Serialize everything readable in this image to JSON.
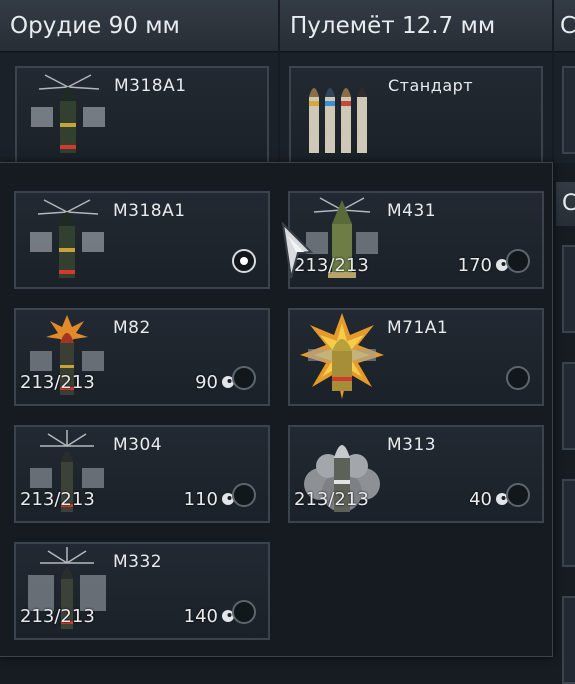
{
  "columns": {
    "gun_title": "Орудие 90 мм",
    "mg_title": "Пулемёт 12.7 мм",
    "third_title": "С",
    "side_title": "С"
  },
  "top_row": [
    {
      "name": "M318A1",
      "icon": "ap-shell-icon"
    },
    {
      "name": "Стандарт",
      "icon": "mg-belt-icon"
    }
  ],
  "shells": [
    {
      "name": "M318A1",
      "count": "",
      "cost": "",
      "selected": true,
      "icon": "ap-shell-icon"
    },
    {
      "name": "M431",
      "count": "213/213",
      "cost": "170",
      "selected": false,
      "icon": "heat-shell-icon"
    },
    {
      "name": "M82",
      "count": "213/213",
      "cost": "90",
      "selected": false,
      "icon": "apc-shell-icon"
    },
    {
      "name": "M71A1",
      "count": "",
      "cost": "",
      "selected": false,
      "icon": "he-shell-icon"
    },
    {
      "name": "M304",
      "count": "213/213",
      "cost": "110",
      "selected": false,
      "icon": "apcr-shell-icon"
    },
    {
      "name": "M313",
      "count": "213/213",
      "cost": "40",
      "selected": false,
      "icon": "smoke-shell-icon"
    },
    {
      "name": "M332",
      "count": "213/213",
      "cost": "140",
      "selected": false,
      "icon": "apcr-shell-icon"
    }
  ],
  "colors": {
    "accent": "#e2e5e8",
    "band_red": "#d23a2e",
    "band_yellow": "#c9a33a"
  }
}
